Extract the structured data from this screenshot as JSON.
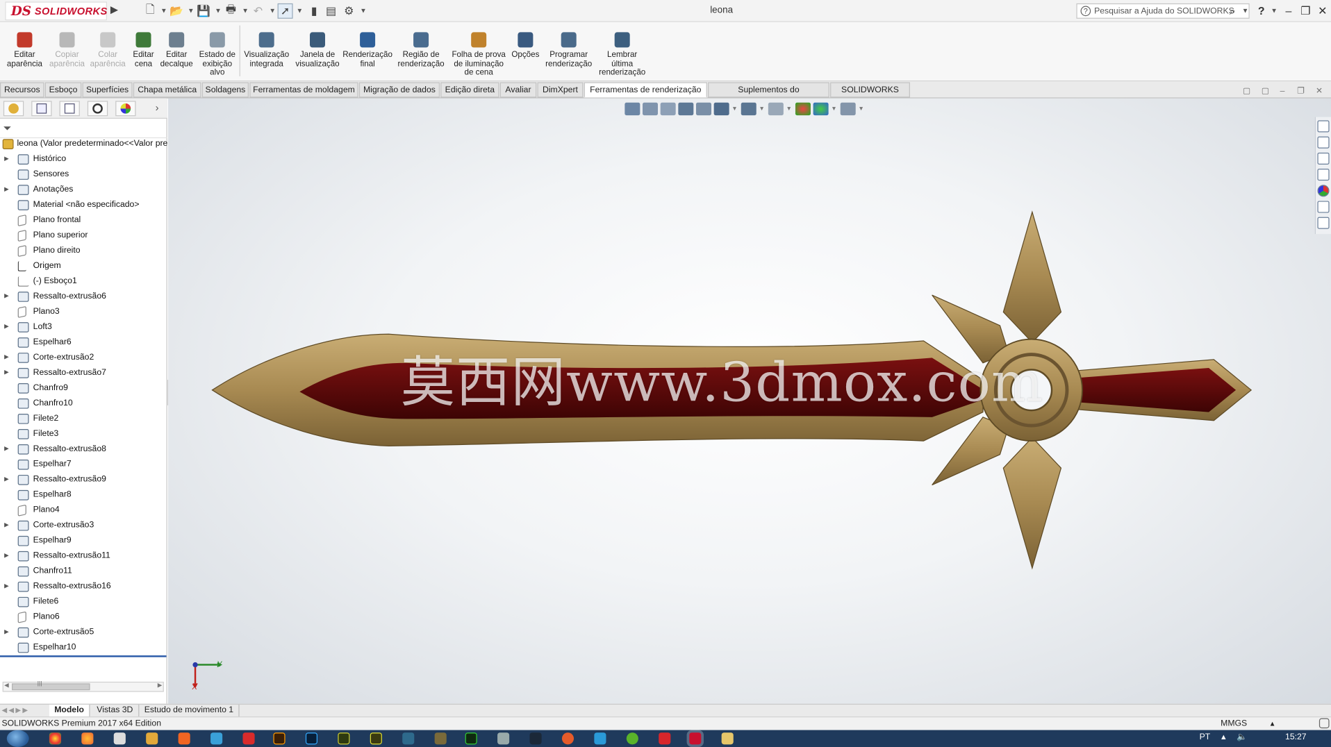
{
  "titlebar": {
    "app_brand_ds": "DS",
    "app_brand_name": "SOLIDWORKS",
    "document_title": "leona",
    "search_placeholder": "Pesquisar a Ajuda do SOLIDWORKS",
    "help_label": "?"
  },
  "ribbon": {
    "buttons": [
      {
        "label": "Editar\naparência",
        "icon": "edit-appearance-icon",
        "enabled": true,
        "color": "#c23a2b"
      },
      {
        "label": "Copiar\naparência",
        "icon": "copy-appearance-icon",
        "enabled": false,
        "color": "#b8b8b8"
      },
      {
        "label": "Colar\naparência",
        "icon": "paste-appearance-icon",
        "enabled": false,
        "color": "#c8c8c8"
      },
      {
        "label": "Editar\ncena",
        "icon": "edit-scene-icon",
        "enabled": true,
        "color": "#3f7a3a"
      },
      {
        "label": "Editar\ndecalque",
        "icon": "edit-decal-icon",
        "enabled": true,
        "color": "#6d7f8f"
      },
      {
        "label": "Estado de\nexibição\nalvo",
        "icon": "display-state-icon",
        "enabled": true,
        "color": "#8a9aa8"
      },
      {
        "label": "Visualização\nintegrada",
        "icon": "integrated-preview-icon",
        "enabled": true,
        "color": "#4d6d8c"
      },
      {
        "label": "Janela de\nvisualização",
        "icon": "preview-window-icon",
        "enabled": true,
        "color": "#3b5b7a"
      },
      {
        "label": "Renderização\nfinal",
        "icon": "final-render-icon",
        "enabled": true,
        "color": "#2e5f99"
      },
      {
        "label": "Região de\nrenderização",
        "icon": "render-region-icon",
        "enabled": true,
        "color": "#4a6c8f"
      },
      {
        "label": "Folha de prova\nde iluminação\nde cena",
        "icon": "scene-proof-sheet-icon",
        "enabled": true,
        "color": "#c0822c"
      },
      {
        "label": "Opções",
        "icon": "options-icon",
        "enabled": true,
        "color": "#3a5a80"
      },
      {
        "label": "Programar\nrenderização",
        "icon": "schedule-render-icon",
        "enabled": true,
        "color": "#4a6a8a"
      },
      {
        "label": "Lembrar\núltima\nrenderização",
        "icon": "recall-last-render-icon",
        "enabled": true,
        "color": "#3d5f7f"
      }
    ]
  },
  "command_tabs": [
    "Recursos",
    "Esboço",
    "Superfícies",
    "Chapa metálica",
    "Soldagens",
    "Ferramentas de moldagem",
    "Migração de dados",
    "Edição direta",
    "Avaliar",
    "DimXpert",
    "Ferramentas de renderização",
    "Suplementos do SOLIDWORKS",
    "SOLIDWORKS MBD"
  ],
  "active_command_tab": "Ferramentas de renderização",
  "feature_tree": {
    "root_label": "leona  (Valor predeterminado<<Valor pre",
    "items": [
      {
        "label": "Histórico",
        "expandable": true,
        "kind": "folder"
      },
      {
        "label": "Sensores",
        "expandable": false,
        "kind": "sensor"
      },
      {
        "label": "Anotações",
        "expandable": true,
        "kind": "annotation"
      },
      {
        "label": "Material <não especificado>",
        "expandable": false,
        "kind": "material"
      },
      {
        "label": "Plano frontal",
        "expandable": false,
        "kind": "plane"
      },
      {
        "label": "Plano superior",
        "expandable": false,
        "kind": "plane"
      },
      {
        "label": "Plano direito",
        "expandable": false,
        "kind": "plane"
      },
      {
        "label": "Origem",
        "expandable": false,
        "kind": "origin"
      },
      {
        "label": "(-) Esboço1",
        "expandable": false,
        "kind": "sketch"
      },
      {
        "label": "Ressalto-extrusão6",
        "expandable": true,
        "kind": "feature"
      },
      {
        "label": "Plano3",
        "expandable": false,
        "kind": "plane"
      },
      {
        "label": "Loft3",
        "expandable": true,
        "kind": "feature"
      },
      {
        "label": "Espelhar6",
        "expandable": false,
        "kind": "feature"
      },
      {
        "label": "Corte-extrusão2",
        "expandable": true,
        "kind": "feature"
      },
      {
        "label": "Ressalto-extrusão7",
        "expandable": true,
        "kind": "feature"
      },
      {
        "label": "Chanfro9",
        "expandable": false,
        "kind": "feature"
      },
      {
        "label": "Chanfro10",
        "expandable": false,
        "kind": "feature"
      },
      {
        "label": "Filete2",
        "expandable": false,
        "kind": "feature"
      },
      {
        "label": "Filete3",
        "expandable": false,
        "kind": "feature"
      },
      {
        "label": "Ressalto-extrusão8",
        "expandable": true,
        "kind": "feature"
      },
      {
        "label": "Espelhar7",
        "expandable": false,
        "kind": "feature"
      },
      {
        "label": "Ressalto-extrusão9",
        "expandable": true,
        "kind": "feature"
      },
      {
        "label": "Espelhar8",
        "expandable": false,
        "kind": "feature"
      },
      {
        "label": "Plano4",
        "expandable": false,
        "kind": "plane"
      },
      {
        "label": "Corte-extrusão3",
        "expandable": true,
        "kind": "feature"
      },
      {
        "label": "Espelhar9",
        "expandable": false,
        "kind": "feature"
      },
      {
        "label": "Ressalto-extrusão11",
        "expandable": true,
        "kind": "feature"
      },
      {
        "label": "Chanfro11",
        "expandable": false,
        "kind": "feature"
      },
      {
        "label": "Ressalto-extrusão16",
        "expandable": true,
        "kind": "feature"
      },
      {
        "label": "Filete6",
        "expandable": false,
        "kind": "feature"
      },
      {
        "label": "Plano6",
        "expandable": false,
        "kind": "plane"
      },
      {
        "label": "Corte-extrusão5",
        "expandable": true,
        "kind": "feature"
      },
      {
        "label": "Espelhar10",
        "expandable": false,
        "kind": "feature"
      }
    ]
  },
  "viewport": {
    "watermark": "莫西网www.3dmox.com",
    "model_colors": {
      "gold": "#a88a52",
      "gold_light": "#c9ad74",
      "gold_dark": "#7b6235",
      "red": "#5a0a0a"
    }
  },
  "triad": {
    "x_label": "X",
    "y_label": "Y"
  },
  "bottom_tabs": [
    "Modelo",
    "Vistas 3D",
    "Estudo de movimento 1"
  ],
  "active_bottom_tab": "Modelo",
  "status_bar": {
    "product": "SOLIDWORKS Premium 2017 x64 Edition",
    "units": "MMGS"
  },
  "taskbar": {
    "language": "PT",
    "time": "15:27"
  }
}
